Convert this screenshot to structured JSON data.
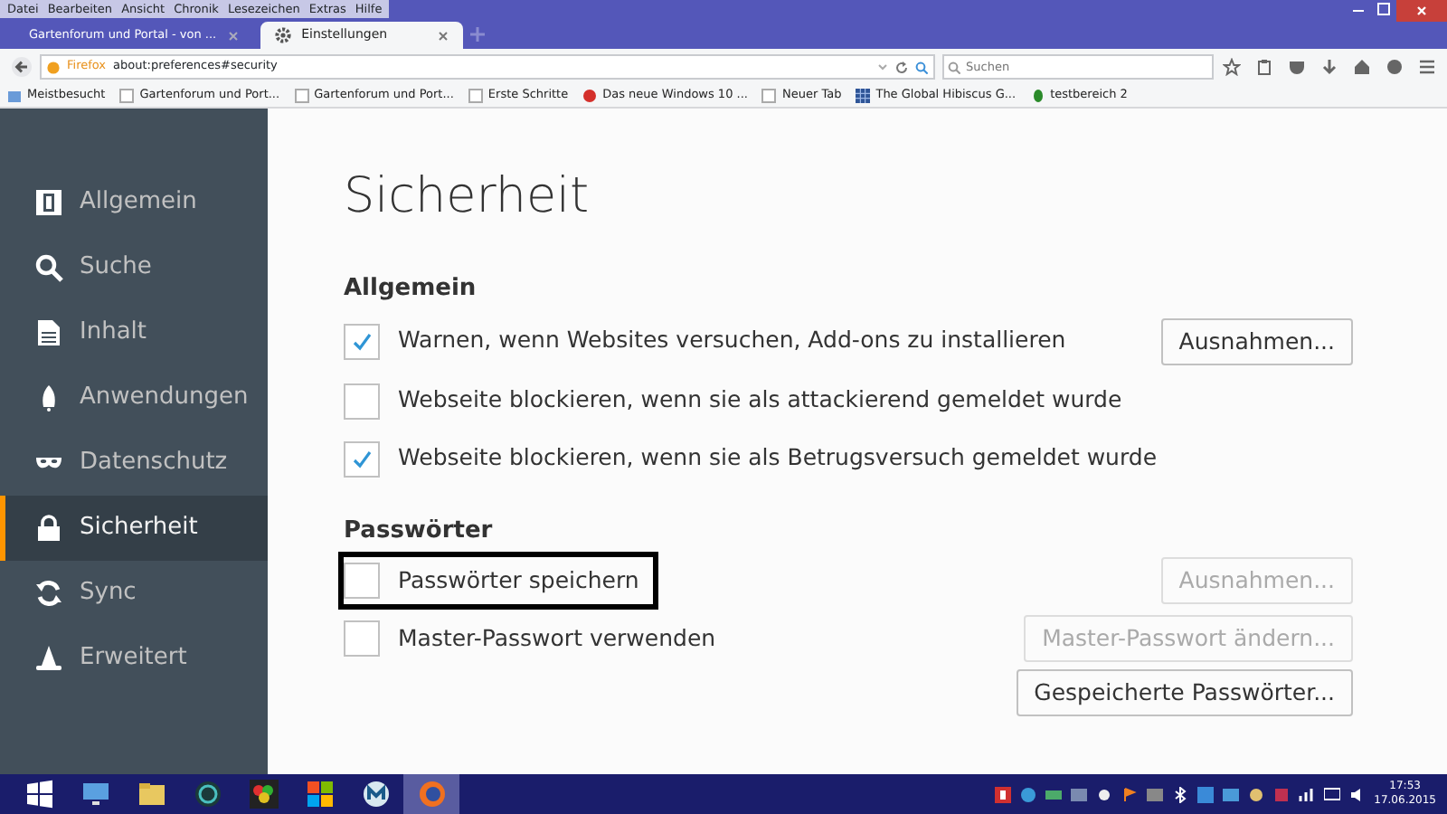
{
  "menu_bar": [
    "Datei",
    "Bearbeiten",
    "Ansicht",
    "Chronik",
    "Lesezeichen",
    "Extras",
    "Hilfe"
  ],
  "tabs": [
    {
      "label": "Gartenforum und Portal - von ...",
      "selected": false
    },
    {
      "label": "Einstellungen",
      "selected": true
    }
  ],
  "address_bar": {
    "identity": "Firefox",
    "url": "about:preferences#security"
  },
  "search": {
    "placeholder": "Suchen"
  },
  "bookmarks": [
    {
      "label": "Meistbesucht",
      "kind": "folder"
    },
    {
      "label": "Gartenforum und Port...",
      "kind": "page"
    },
    {
      "label": "Gartenforum und Port...",
      "kind": "page"
    },
    {
      "label": "Erste Schritte",
      "kind": "page"
    },
    {
      "label": "Das neue Windows 10 ...",
      "kind": "red"
    },
    {
      "label": "Neuer Tab",
      "kind": "page"
    },
    {
      "label": "The Global Hibiscus G...",
      "kind": "grid"
    },
    {
      "label": "testbereich 2",
      "kind": "leaf"
    }
  ],
  "sidebar": {
    "items": [
      {
        "label": "Allgemein",
        "selected": false
      },
      {
        "label": "Suche",
        "selected": false
      },
      {
        "label": "Inhalt",
        "selected": false
      },
      {
        "label": "Anwendungen",
        "selected": false
      },
      {
        "label": "Datenschutz",
        "selected": false
      },
      {
        "label": "Sicherheit",
        "selected": true
      },
      {
        "label": "Sync",
        "selected": false
      },
      {
        "label": "Erweitert",
        "selected": false
      }
    ]
  },
  "page": {
    "title": "Sicherheit",
    "sections": [
      {
        "heading": "Allgemein",
        "rows": [
          {
            "kind": "checkbox",
            "label": "Warnen, wenn Websites versuchen, Add-ons zu installieren",
            "checked": true,
            "highlighted": false,
            "button": {
              "label": "Ausnahmen...",
              "disabled": false
            }
          },
          {
            "kind": "checkbox",
            "label": "Webseite blockieren, wenn sie als attackierend gemeldet wurde",
            "checked": false,
            "highlighted": false
          },
          {
            "kind": "checkbox",
            "label": "Webseite blockieren, wenn sie als Betrugsversuch gemeldet wurde",
            "checked": true,
            "highlighted": false
          }
        ]
      },
      {
        "heading": "Passwörter",
        "rows": [
          {
            "kind": "checkbox",
            "label": "Passwörter speichern",
            "checked": false,
            "highlighted": true,
            "button": {
              "label": "Ausnahmen...",
              "disabled": true
            }
          },
          {
            "kind": "checkbox",
            "label": "Master-Passwort verwenden",
            "checked": false,
            "highlighted": false,
            "button": {
              "label": "Master-Passwort ändern...",
              "disabled": true
            }
          },
          {
            "kind": "button",
            "button": {
              "label": "Gespeicherte Passwörter...",
              "disabled": false
            }
          }
        ]
      }
    ]
  },
  "taskbar": {
    "time": "17:53",
    "date": "17.06.2015"
  }
}
